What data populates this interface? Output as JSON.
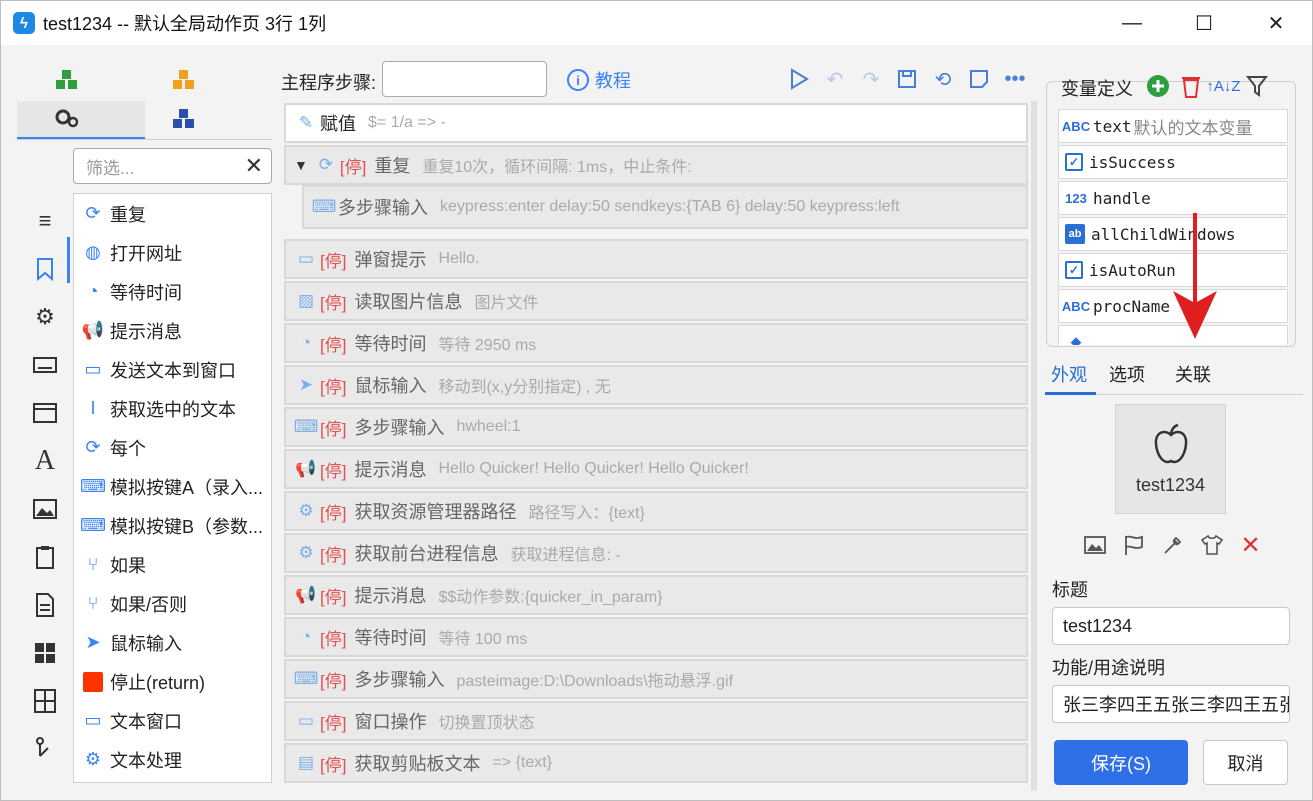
{
  "window": {
    "title": "test1234 -- 默认全局动作页 3行 1列",
    "app_icon": "quicker-bolt-icon",
    "minimize": "—",
    "maximize": "☐",
    "close": "✕"
  },
  "left": {
    "filter_placeholder": "筛选...",
    "filter_clear": "✕",
    "actions": [
      {
        "label": "重复",
        "icon": "repeat-icon"
      },
      {
        "label": "打开网址",
        "icon": "globe-icon"
      },
      {
        "label": "等待时间",
        "icon": "timer-icon"
      },
      {
        "label": "提示消息",
        "icon": "megaphone-icon"
      },
      {
        "label": "发送文本到窗口",
        "icon": "message-icon"
      },
      {
        "label": "获取选中的文本",
        "icon": "text-cursor-icon"
      },
      {
        "label": "每个",
        "icon": "repeat-icon"
      },
      {
        "label": "模拟按键A（录入...",
        "icon": "keyboard-icon"
      },
      {
        "label": "模拟按键B（参数...",
        "icon": "keyboard-icon"
      },
      {
        "label": "如果",
        "icon": "branch-icon"
      },
      {
        "label": "如果/否则",
        "icon": "branch-icon"
      },
      {
        "label": "鼠标输入",
        "icon": "cursor-icon"
      },
      {
        "label": "停止(return)",
        "icon": "stop-icon"
      },
      {
        "label": "文本窗口",
        "icon": "window-icon"
      },
      {
        "label": "文本处理",
        "icon": "gear-icon"
      }
    ]
  },
  "main": {
    "steps_label": "主程序步骤:",
    "steps_input_value": "",
    "tutorial_label": "教程",
    "stop_tag": "[停]",
    "steps": [
      {
        "name": "赋值",
        "desc": "$= 1/a => -",
        "icon": "edit-icon",
        "stopped": false
      },
      {
        "name": "重复",
        "desc": "重复10次，循环间隔: 1ms，中止条件:",
        "icon": "repeat-icon",
        "stopped": true,
        "expanded": true
      },
      {
        "name": "多步骤输入",
        "desc": "keypress:enter  delay:50  sendkeys:{TAB 6}  delay:50  keypress:left",
        "icon": "keyboard-icon",
        "stopped": false,
        "nested": true
      },
      {
        "name": "弹窗提示",
        "desc": "Hello.",
        "icon": "window-icon",
        "stopped": true
      },
      {
        "name": "读取图片信息",
        "desc": "图片文件",
        "icon": "image-icon",
        "stopped": true
      },
      {
        "name": "等待时间",
        "desc": "等待 2950 ms",
        "icon": "timer-icon",
        "stopped": true
      },
      {
        "name": "鼠标输入",
        "desc": "移动到(x,y分别指定) , 无",
        "icon": "cursor-icon",
        "stopped": true
      },
      {
        "name": "多步骤输入",
        "desc": "hwheel:1",
        "icon": "keyboard-icon",
        "stopped": true
      },
      {
        "name": "提示消息",
        "desc": "Hello Quicker!  Hello Quicker!  Hello Quicker!",
        "icon": "megaphone-icon",
        "stopped": true
      },
      {
        "name": "获取资源管理器路径",
        "desc": "路径写入：{text}",
        "icon": "gear-icon",
        "stopped": true
      },
      {
        "name": "获取前台进程信息",
        "desc": "获取进程信息: -",
        "icon": "gear-icon",
        "stopped": true
      },
      {
        "name": "提示消息",
        "desc": "$$动作参数:{quicker_in_param}",
        "icon": "megaphone-icon",
        "stopped": true
      },
      {
        "name": "等待时间",
        "desc": "等待 100 ms",
        "icon": "timer-icon",
        "stopped": true
      },
      {
        "name": "多步骤输入",
        "desc": "pasteimage:D:\\Downloads\\拖动悬浮.gif",
        "icon": "keyboard-icon",
        "stopped": true
      },
      {
        "name": "窗口操作",
        "desc": "切换置顶状态",
        "icon": "window-icon",
        "stopped": true
      },
      {
        "name": "获取剪贴板文本",
        "desc": "=> {text}",
        "icon": "clipboard-icon",
        "stopped": true
      }
    ]
  },
  "variables": {
    "title": "变量定义",
    "items": [
      {
        "badge": "ABC",
        "name": "text",
        "desc": "默认的文本变量",
        "icon": "text-type-icon"
      },
      {
        "badge": "✓",
        "name": "isSuccess",
        "desc": "",
        "icon": "bool-type-icon"
      },
      {
        "badge": "123",
        "name": "handle",
        "desc": "",
        "icon": "number-type-icon"
      },
      {
        "badge": "ab",
        "name": "allChildWindows",
        "desc": "",
        "icon": "list-type-icon"
      },
      {
        "badge": "✓",
        "name": "isAutoRun",
        "desc": "",
        "icon": "bool-type-icon"
      },
      {
        "badge": "ABC",
        "name": "procName",
        "desc": "",
        "icon": "text-type-icon"
      },
      {
        "badge": "◆",
        "name": "",
        "desc": "",
        "icon": "object-type-icon"
      }
    ]
  },
  "right": {
    "tabs": [
      "外观",
      "选项",
      "关联"
    ],
    "active_tab": "外观",
    "icon_label": "test1234",
    "title_label": "标题",
    "title_value": "test1234",
    "desc_label": "功能/用途说明",
    "desc_value": "张三李四王五张三李四王五张",
    "save_label": "保存(S)",
    "cancel_label": "取消"
  },
  "colors": {
    "accent": "#2f6fe8",
    "stop_red": "#e05050",
    "annotation_red": "#e02020"
  }
}
